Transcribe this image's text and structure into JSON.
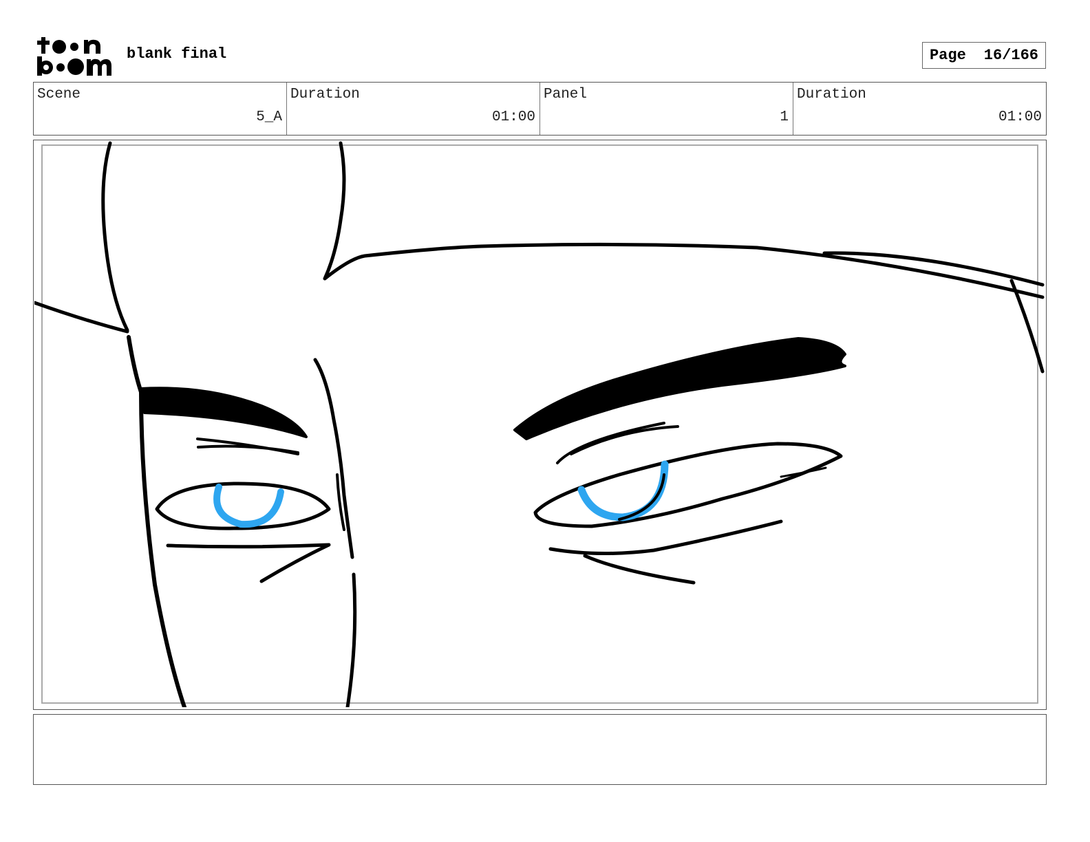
{
  "header": {
    "logo_text": "toon boom",
    "project_title": "blank final",
    "page_label": "Page",
    "page_value": "16/166"
  },
  "info": {
    "scene_label": "Scene",
    "scene_value": "5_A",
    "scene_duration_label": "Duration",
    "scene_duration_value": "01:00",
    "panel_label": "Panel",
    "panel_value": "1",
    "panel_duration_label": "Duration",
    "panel_duration_value": "01:00"
  },
  "panel": {
    "iris_color": "#2ea6f0",
    "line_color": "#000000"
  },
  "notes": {
    "text": ""
  }
}
